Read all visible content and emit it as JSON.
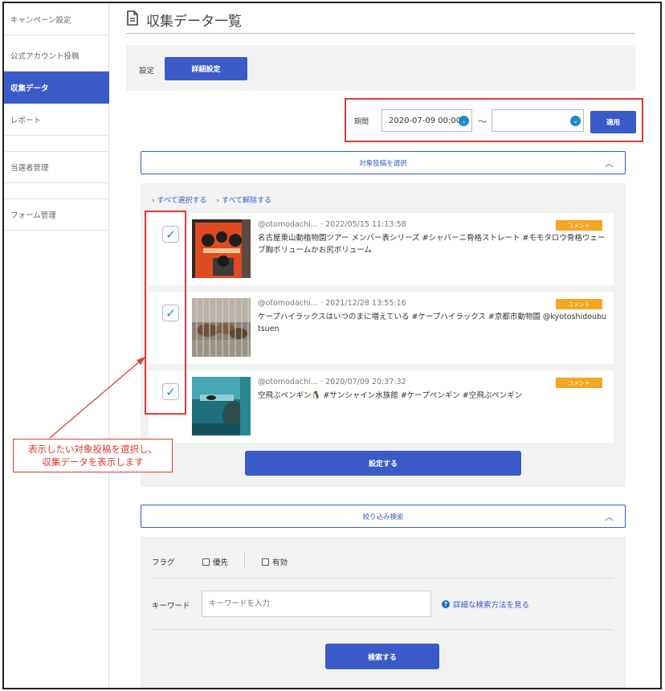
{
  "sidebar": {
    "items": [
      {
        "label": "キャンペーン設定",
        "active": false
      },
      {
        "label": "公式アカウント投稿",
        "active": false
      },
      {
        "label": "収集データ",
        "active": true
      },
      {
        "label": "レポート",
        "active": false
      },
      {
        "label": "当選者管理",
        "active": false
      },
      {
        "label": "フォーム管理",
        "active": false
      }
    ]
  },
  "header": {
    "title": "収集データ一覧"
  },
  "settings": {
    "label": "設定",
    "detail_button": "詳細設定"
  },
  "period": {
    "label": "期間",
    "start": "2020-07-09 00:00",
    "separator": "〜",
    "end": "",
    "apply_button": "適用"
  },
  "target_posts": {
    "accordion_label": "対象投稿を選択",
    "select_all": "すべて選択する",
    "deselect_all": "すべて解除する",
    "posts": [
      {
        "meta": "@otomodachi… · 2022/05/15 11:13:58",
        "text": "名古屋東山動植物園ツアー メンバー表シリーズ #シャバーニ骨格ストレート #モモタロウ骨格ウェーブ胸ボリュームかお尻ボリューム",
        "badge": "コメント",
        "checked": true
      },
      {
        "meta": "@otomodachi… · 2021/12/28 13:55:16",
        "text": "ケープハイラックスはいつのまに増えている #ケープハイラックス #京都市動物園 @kyotoshidoubutsuen",
        "badge": "コメント",
        "checked": true
      },
      {
        "meta": "@otomodachi… · 2020/07/09 20:37:32",
        "text": "空飛ぶペンギン🐧 #サンシャイン水族館 #ケープペンギン #空飛ぶペンギン",
        "badge": "コメント",
        "checked": true
      }
    ],
    "submit_button": "設定する"
  },
  "filter": {
    "accordion_label": "絞り込み検索",
    "flag_label": "フラグ",
    "flag_priority": "優先",
    "flag_valid": "有効",
    "keyword_label": "キーワード",
    "keyword_placeholder": "キーワードを入力",
    "help_link": "詳細な検索方法を見る",
    "search_button": "検索する"
  },
  "annotation": {
    "line1": "表示したい対象投稿を選択し、",
    "line2": "収集データを表示します"
  },
  "colors": {
    "primary": "#3a5bc7",
    "badge": "#f5a623",
    "annotation": "#e03a2f",
    "check": "#1f8ac5"
  }
}
